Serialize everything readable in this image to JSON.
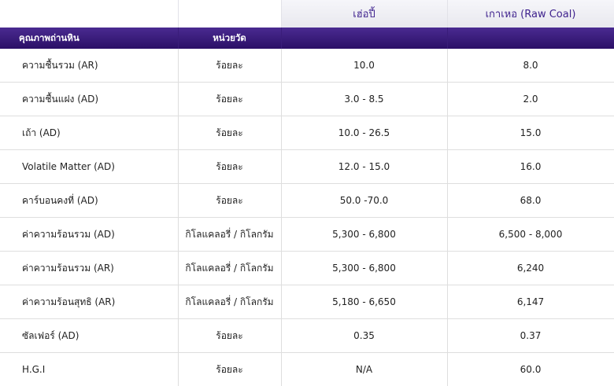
{
  "header": {
    "col_heo_pee": "เฮ่อปี้",
    "col_raw_coal": "เกาเหอ (Raw Coal)",
    "col_quality": "คุณภาพถ่านหิน",
    "col_unit": "หน่วยวัด"
  },
  "rows": [
    {
      "name": "ความชื้นรวม (AR)",
      "unit": "ร้อยละ",
      "heo_pee": "10.0",
      "raw_coal": "8.0"
    },
    {
      "name": "ความชื้นแฝง (AD)",
      "unit": "ร้อยละ",
      "heo_pee": "3.0 - 8.5",
      "raw_coal": "2.0"
    },
    {
      "name": "เถ้า (AD)",
      "unit": "ร้อยละ",
      "heo_pee": "10.0 - 26.5",
      "raw_coal": "15.0"
    },
    {
      "name": "Volatile Matter (AD)",
      "unit": "ร้อยละ",
      "heo_pee": "12.0 - 15.0",
      "raw_coal": "16.0"
    },
    {
      "name": "คาร์บอนคงที่ (AD)",
      "unit": "ร้อยละ",
      "heo_pee": "50.0 -70.0",
      "raw_coal": "68.0"
    },
    {
      "name": "ค่าความร้อนรวม (AD)",
      "unit": "กิโลแคลอรี่ / กิโลกรัม",
      "heo_pee": "5,300 - 6,800",
      "raw_coal": "6,500 - 8,000"
    },
    {
      "name": "ค่าความร้อนรวม (AR)",
      "unit": "กิโลแคลอรี่ / กิโลกรัม",
      "heo_pee": "5,300 - 6,800",
      "raw_coal": "6,240"
    },
    {
      "name": "ค่าความร้อนสุทธิ (AR)",
      "unit": "กิโลแคลอรี่ / กิโลกรัม",
      "heo_pee": "5,180 - 6,650",
      "raw_coal": "6,147"
    },
    {
      "name": "ซัลเฟอร์ (AD)",
      "unit": "ร้อยละ",
      "heo_pee": "0.35",
      "raw_coal": "0.37"
    },
    {
      "name": "H.G.I",
      "unit": "ร้อยละ",
      "heo_pee": "N/A",
      "raw_coal": "60.0"
    }
  ]
}
